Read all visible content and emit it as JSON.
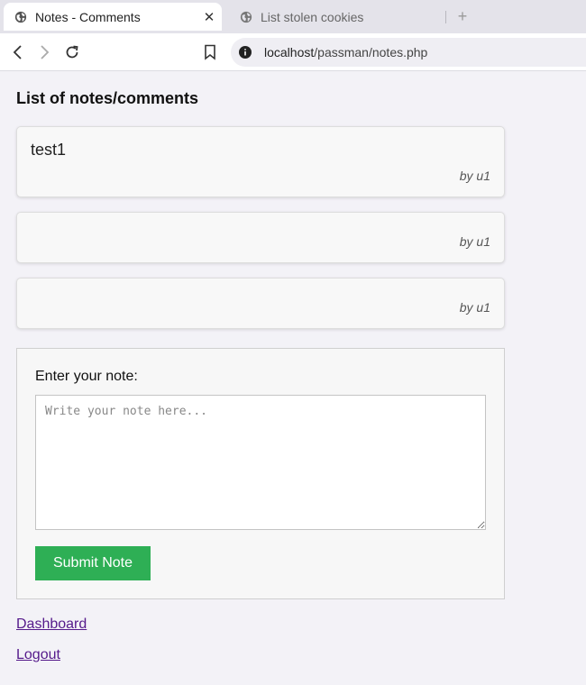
{
  "browser": {
    "tabs": [
      {
        "title": "Notes - Comments",
        "active": true
      },
      {
        "title": "List stolen cookies",
        "active": false
      }
    ],
    "close_glyph": "✕",
    "newtab_glyph": "+",
    "url": {
      "host": "localhost",
      "path": "/passman/notes.php"
    }
  },
  "page": {
    "heading": "List of notes/comments",
    "notes": [
      {
        "text": "test1",
        "author": "by u1"
      },
      {
        "text": "",
        "author": "by u1"
      },
      {
        "text": "",
        "author": "by u1"
      }
    ],
    "form": {
      "label": "Enter your note:",
      "placeholder": "Write your note here...",
      "value": "",
      "submit_label": "Submit Note"
    },
    "links": {
      "dashboard": "Dashboard",
      "logout": "Logout"
    }
  },
  "icons": {
    "tab_icon": "globe-icon",
    "back": "back-arrow-icon",
    "forward": "forward-arrow-icon",
    "reload": "reload-icon",
    "bookmark": "bookmark-icon",
    "site_info": "info-icon"
  },
  "colors": {
    "submit_button": "#2eaf55",
    "visited_link": "#551a8b",
    "page_background": "#f3f2f7"
  }
}
